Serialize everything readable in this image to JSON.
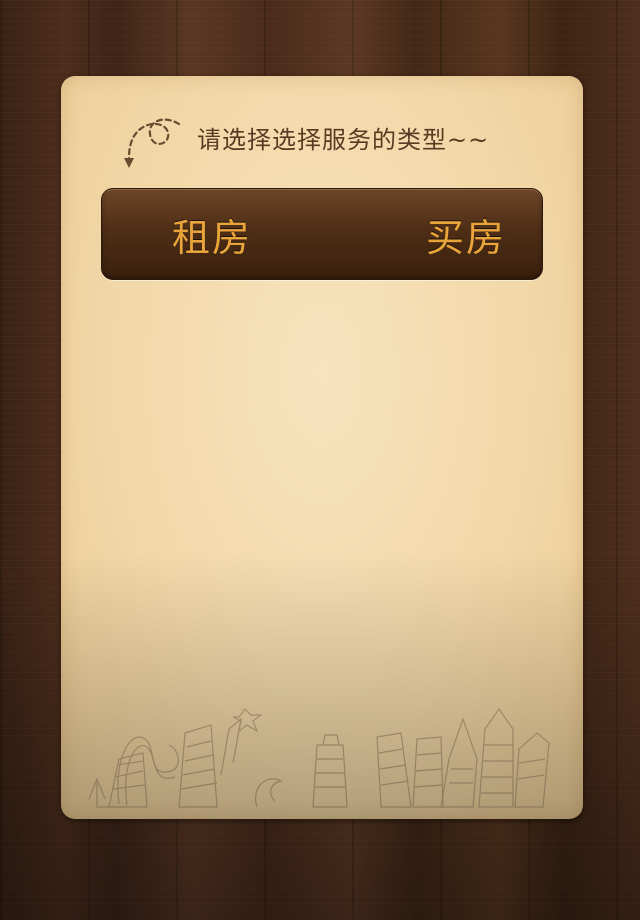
{
  "prompt": {
    "text": "请选择选择服务的类型~~",
    "icon": "curl-arrow-icon"
  },
  "segment": {
    "options": [
      {
        "label": "租房"
      },
      {
        "label": "买房"
      }
    ]
  },
  "colors": {
    "card_bg": "#f2d8a8",
    "segment_bg": "#4e2e16",
    "segment_text": "#e9a53a",
    "prompt_text": "#5a3a22"
  }
}
